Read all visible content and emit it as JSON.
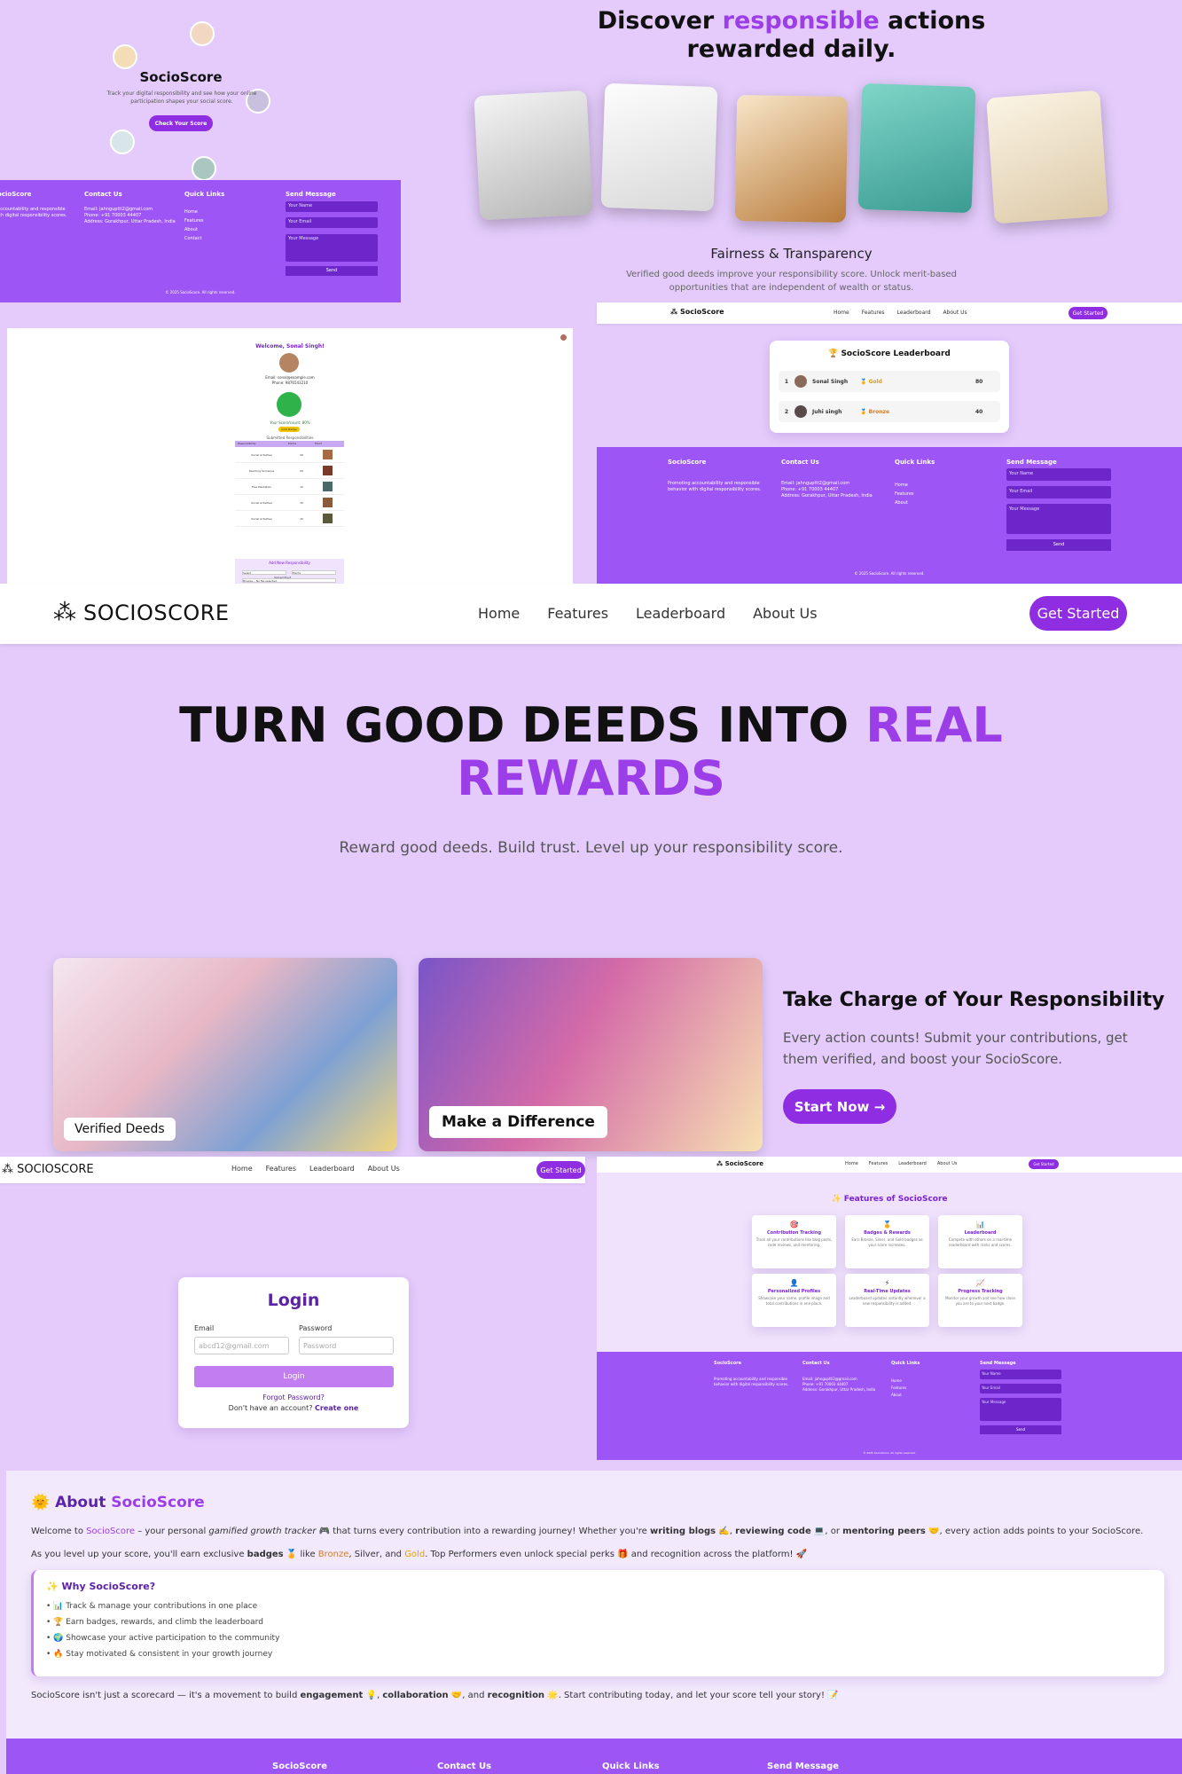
{
  "brand": {
    "name": "SocioScore",
    "logo_text": "SOCIOSCORE"
  },
  "nav": {
    "home": "Home",
    "features": "Features",
    "leaderboard": "Leaderboard",
    "about": "About Us",
    "cta": "Get Started"
  },
  "panel_a": {
    "title": "SocioScore",
    "desc": "Track your digital responsibility and see how your online participation shapes your social score.",
    "button": "Check Your Score"
  },
  "footer": {
    "col_brand": "SocioScore",
    "brand_desc": "Promoting accountability and responsible behavior with digital responsibility scores.",
    "col_contact": "Contact Us",
    "email": "Email: jahnguptti2@gmail.com",
    "phone": "Phone: +91 70003 44407",
    "address": "Address: Gorakhpur, Uttar Pradesh, India",
    "col_links": "Quick Links",
    "links": [
      "Home",
      "Features",
      "About",
      "Contact"
    ],
    "col_msg": "Send Message",
    "ph_name": "Your Name",
    "ph_email": "Your Email",
    "ph_msg": "Your Message",
    "send": "Send",
    "copyright": "© 2025 SocioScore. All rights reserved."
  },
  "discover": {
    "pre": "Discover ",
    "highlight": "responsible",
    "post": " actions",
    "line2": "rewarded daily.",
    "subtitle": "Fairness & Transparency",
    "desc": "Verified good deeds improve your responsibility score. Unlock merit-based opportunities that are independent of wealth or status."
  },
  "profile": {
    "welcome": "Welcome, Sonal Singh!",
    "email": "Email: sonal@example.com",
    "phone": "Phone: 9876543210",
    "score_label": "Your Score/count: 80%",
    "badge": "Gold Badge",
    "table_title": "Submitted Responsibilities",
    "headers": [
      "Responsibility",
      "Points",
      "Proof"
    ],
    "rows": [
      [
        "Social Activities",
        "20"
      ],
      [
        "Teaching Someone",
        "20"
      ],
      [
        "Tree Plantation",
        "10"
      ],
      [
        "Social Activities",
        "15"
      ],
      [
        "Social Activities",
        "15"
      ]
    ],
    "add_title": "Add New Responsibility",
    "add_select": "Select",
    "add_points": "Points",
    "add_upload": "Upload Proof",
    "add_file": "Browse... No file selected."
  },
  "leaderboard": {
    "title": "SocioScore Leaderboard",
    "rows": [
      {
        "rank": "1",
        "name": "Sonal Singh",
        "badge": "Gold",
        "score": "80"
      },
      {
        "rank": "2",
        "name": "Juhi singh",
        "badge": "Bronze",
        "score": "40"
      }
    ]
  },
  "hero": {
    "line1": "TURN GOOD DEEDS INTO ",
    "highlight1": "REAL",
    "highlight2": "REWARDS",
    "subtitle": "Reward good deeds. Build trust. Level up your responsibility score.",
    "card1_label": "Verified Deeds",
    "card2_label": "Make a Difference",
    "side_title": "Take Charge of Your Responsibility",
    "side_desc": "Every action counts! Submit your contributions, get them verified, and boost your SocioScore.",
    "side_button": "Start Now →"
  },
  "login": {
    "title": "Login",
    "email_label": "Email",
    "password_label": "Password",
    "email_ph": "abcd12@gmail.com",
    "password_ph": "Password",
    "button": "Login",
    "forgot": "Forgot Password?",
    "no_account": "Don't have an account? ",
    "create": "Create one"
  },
  "features": {
    "title": "✨ Features of SocioScore",
    "items": [
      {
        "icon": "🎯",
        "title": "Contribution Tracking",
        "desc": "Track all your contributions like blog posts, code reviews, and mentoring."
      },
      {
        "icon": "🏅",
        "title": "Badges & Rewards",
        "desc": "Earn Bronze, Silver, and Gold badges as your score increases."
      },
      {
        "icon": "📊",
        "title": "Leaderboard",
        "desc": "Compete with others on a real-time leaderboard with ranks and scores."
      },
      {
        "icon": "👤",
        "title": "Personalized Profiles",
        "desc": "Showcase your name, profile image and total contributions in one place."
      },
      {
        "icon": "⚡",
        "title": "Real-Time Updates",
        "desc": "Leaderboard updates instantly whenever a new responsibility is added."
      },
      {
        "icon": "📈",
        "title": "Progress Tracking",
        "desc": "Monitor your growth and see how close you are to your next badge."
      }
    ]
  },
  "about": {
    "title_pre": "About ",
    "title_hl": "SocioScore",
    "icon": "🌞",
    "p1_a": "Welcome to ",
    "p1_brand": "SocioScore",
    "p1_b": " – your personal ",
    "p1_em": "gamified growth tracker",
    "p1_c": " 🎮 that turns every contribution into a rewarding journey! Whether you're ",
    "p1_s1": "writing blogs",
    "p1_d": " ✍️, ",
    "p1_s2": "reviewing code",
    "p1_e": " 💻, or ",
    "p1_s3": "mentoring peers",
    "p1_f": " 🤝, every action adds points to your SocioScore.",
    "p2_a": "As you level up your score, you'll earn exclusive ",
    "p2_s": "badges",
    "p2_b": " 🏅 like ",
    "p2_bronze": "Bronze",
    "p2_c": ", Silver, and ",
    "p2_gold": "Gold",
    "p2_d": ". Top Performers even unlock special perks 🎁 and recognition across the platform! 🚀",
    "why_title": "✨ Why SocioScore?",
    "why": [
      "📊 Track & manage your contributions in one place",
      "🏆 Earn badges, rewards, and climb the leaderboard",
      "🌍 Showcase your active participation to the community",
      "🔥 Stay motivated & consistent in your growth journey"
    ],
    "p3_a": "SocioScore isn't just a scorecard — it's a movement to build ",
    "p3_s1": "engagement",
    "p3_b": " 💡, ",
    "p3_s2": "collaboration",
    "p3_c": " 🤝, and ",
    "p3_s3": "recognition",
    "p3_d": " 🌟. Start contributing today, and let your score tell your story! 📝"
  },
  "bottom_footer": {
    "brand": "SocioScore",
    "contact": "Contact Us",
    "links": "Quick Links",
    "msg": "Send Message"
  },
  "colors": {
    "accent": "#8e2de2",
    "bg": "#e4cbfb",
    "footer": "#9d55f5",
    "gold": "#e0a100",
    "bronze": "#cd7f32"
  }
}
